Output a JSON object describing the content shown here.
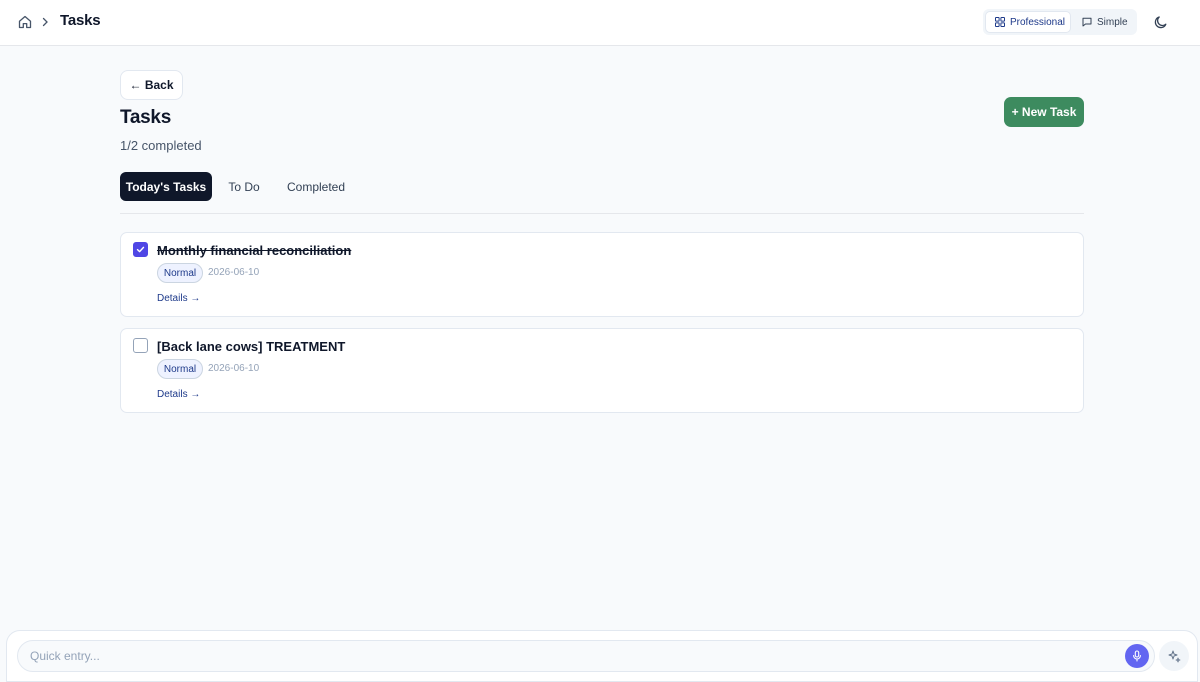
{
  "header": {
    "breadcrumb_title": "Tasks",
    "modes": [
      {
        "label": "Professional",
        "icon": "grid-icon",
        "active": true
      },
      {
        "label": "Simple",
        "icon": "chat-icon",
        "active": false
      }
    ],
    "theme_icon": "moon-icon"
  },
  "page": {
    "back_label": "← Back",
    "title": "Tasks",
    "progress": "1/2 completed",
    "new_task_label": "+ New Task"
  },
  "tabs": [
    {
      "label": "Today's Tasks",
      "active": true
    },
    {
      "label": "To Do",
      "active": false
    },
    {
      "label": "Completed",
      "active": false
    }
  ],
  "tasks": [
    {
      "title": "Monthly financial reconciliation",
      "priority": "Normal",
      "date": "2026-06-10",
      "completed": true,
      "details_label": "Details →"
    },
    {
      "title": "[Back lane cows] TREATMENT",
      "priority": "Normal",
      "date": "2026-06-10",
      "completed": false,
      "details_label": "Details →"
    }
  ],
  "quick_entry": {
    "placeholder": "Quick entry...",
    "mic_icon": "microphone-icon",
    "sparkle_icon": "sparkle-icon"
  },
  "colors": {
    "accent_green": "#3d8b5f",
    "checkbox_checked": "#4f46e5",
    "active_tab": "#0f172a",
    "mic": "#6366f1"
  }
}
